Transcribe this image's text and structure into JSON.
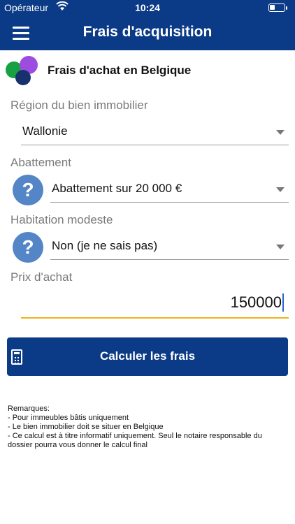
{
  "status_bar": {
    "carrier": "Opérateur",
    "time": "10:24",
    "battery_level": 0.35
  },
  "nav": {
    "title": "Frais d'acquisition",
    "menu_icon": "hamburger-icon"
  },
  "brand": {
    "title": "Frais d'achat en Belgique",
    "logo_colors": [
      "#18a142",
      "#9d4ce0",
      "#17306e"
    ]
  },
  "form": {
    "region": {
      "label": "Région du bien immobilier",
      "value": "Wallonie"
    },
    "abattement": {
      "label": "Abattement",
      "value": "Abattement sur 20 000 €",
      "help": "?"
    },
    "habitation": {
      "label": "Habitation modeste",
      "value": "Non (je ne sais pas)",
      "help": "?"
    },
    "prix": {
      "label": "Prix d'achat",
      "value": "150000"
    }
  },
  "button": {
    "label": "Calculer les frais",
    "icon": "calculator-icon"
  },
  "remarks": {
    "title": "Remarques:",
    "items": [
      "- Pour immeubles bâtis uniquement",
      "- Le bien immobilier doit se situer en Belgique",
      "- Ce calcul est à titre informatif uniquement. Seul le notaire responsable du dossier pourra vous donner le calcul final"
    ]
  },
  "colors": {
    "primary": "#0b3a86",
    "accent": "#f0b21b",
    "help": "#5485c6"
  }
}
